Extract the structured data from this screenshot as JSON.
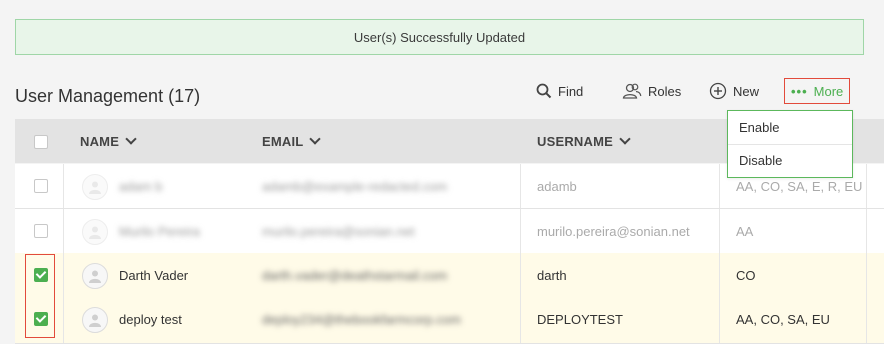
{
  "banner": {
    "message": "User(s) Successfully Updated"
  },
  "page": {
    "title": "User Management (17)"
  },
  "toolbar": {
    "find_label": "Find",
    "roles_label": "Roles",
    "new_label": "New",
    "more_label": "More",
    "more_dots": "•••"
  },
  "dropdown": {
    "items": [
      "Enable",
      "Disable"
    ]
  },
  "table": {
    "columns": [
      "NAME",
      "EMAIL",
      "USERNAME"
    ],
    "rows": [
      {
        "name": "adam b",
        "email": "adamb@example-redacted.com",
        "username": "adamb",
        "roles": "AA, CO, SA, E, R, EU",
        "checked": false,
        "state": "disabled"
      },
      {
        "name": "Murilo Pereira",
        "email": "murilo.pereira@sonian.net",
        "username": "murilo.pereira@sonian.net",
        "roles": "AA",
        "checked": false,
        "state": "disabled"
      },
      {
        "name": "Darth Vader",
        "email": "darth.vader@deathstarmail.com",
        "username": "darth",
        "roles": "CO",
        "checked": true,
        "state": "selected"
      },
      {
        "name": "deploy test",
        "email": "deploy234@thebookfarmcorp.com",
        "username": "DEPLOYTEST",
        "roles": "AA, CO, SA, EU",
        "checked": true,
        "state": "selected"
      }
    ]
  },
  "colors": {
    "banner_bg": "#e8f5e9",
    "banner_border": "#9fd6a7",
    "accent_green": "#4caf50",
    "highlight_red": "#e24a3b",
    "selected_row_bg": "#fffbe8"
  }
}
